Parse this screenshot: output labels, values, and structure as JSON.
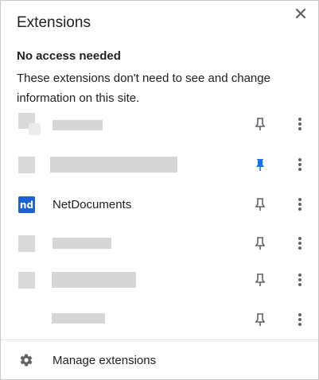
{
  "header": {
    "title": "Extensions",
    "close_icon": "close-icon"
  },
  "section": {
    "heading": "No access needed",
    "description": "These extensions don't need to see and change information on this site."
  },
  "extensions": [
    {
      "name": "",
      "icon": "redacted-extension-icon",
      "pinned": false
    },
    {
      "name": "",
      "icon": "redacted-extension-icon",
      "pinned": true
    },
    {
      "name": "NetDocuments",
      "icon": "netdocuments-icon",
      "icon_text": "nd",
      "pinned": false
    },
    {
      "name": "",
      "icon": "redacted-extension-icon",
      "pinned": false
    },
    {
      "name": "",
      "icon": "redacted-extension-icon",
      "pinned": false
    },
    {
      "name": "",
      "icon": "",
      "pinned": false
    }
  ],
  "footer": {
    "manage_label": "Manage extensions",
    "manage_icon": "gear-icon"
  },
  "colors": {
    "pin_active": "#1a73e8",
    "pin_inactive": "#5f6368",
    "netdocuments_brand": "#1a62d6",
    "redaction": "#d6d6d6"
  }
}
